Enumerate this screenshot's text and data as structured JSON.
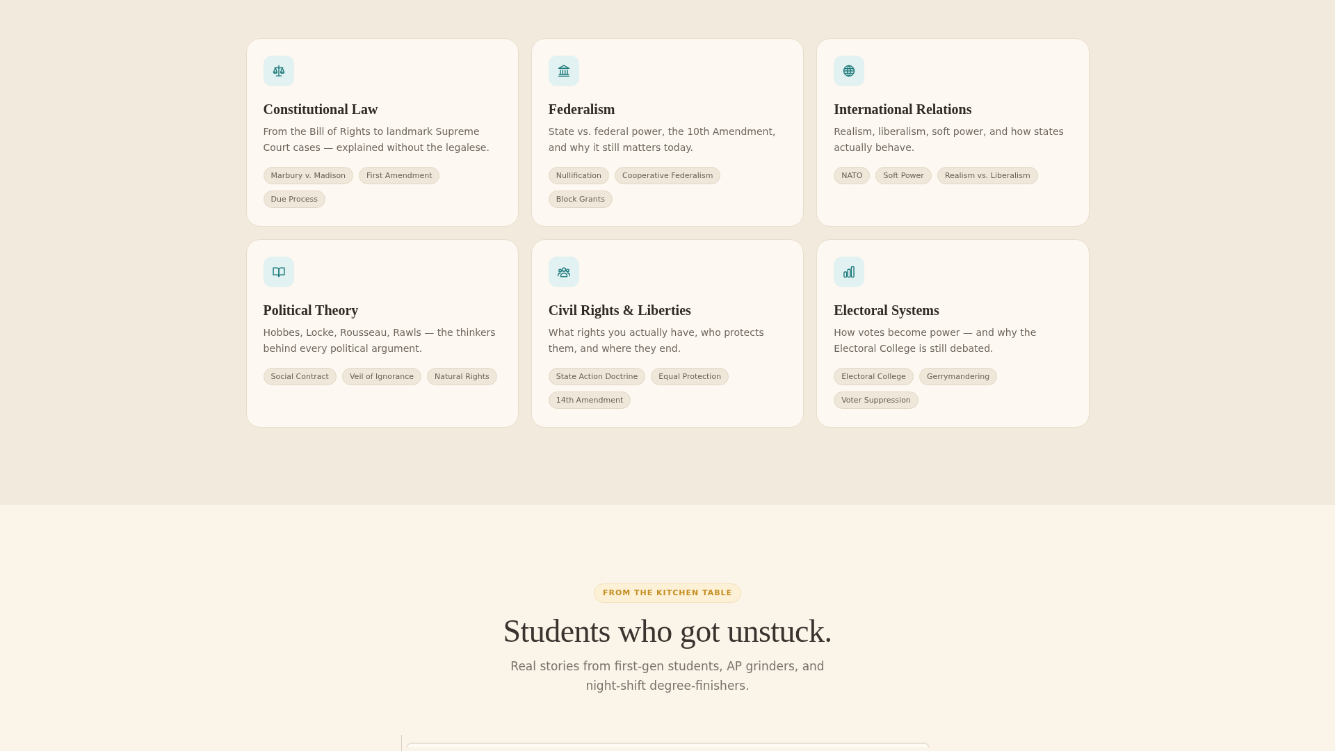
{
  "topics": [
    {
      "title": "Constitutional Law",
      "description": "From the Bill of Rights to landmark Supreme Court cases — explained without the legalese.",
      "tags": [
        "Marbury v. Madison",
        "First Amendment",
        "Due Process"
      ]
    },
    {
      "title": "Federalism",
      "description": "State vs. federal power, the 10th Amendment, and why it still matters today.",
      "tags": [
        "Nullification",
        "Cooperative Federalism",
        "Block Grants"
      ]
    },
    {
      "title": "International Relations",
      "description": "Realism, liberalism, soft power, and how states actually behave.",
      "tags": [
        "NATO",
        "Soft Power",
        "Realism vs. Liberalism"
      ]
    },
    {
      "title": "Political Theory",
      "description": "Hobbes, Locke, Rousseau, Rawls — the thinkers behind every political argument.",
      "tags": [
        "Social Contract",
        "Veil of Ignorance",
        "Natural Rights"
      ]
    },
    {
      "title": "Civil Rights & Liberties",
      "description": "What rights you actually have, who protects them, and where they end.",
      "tags": [
        "State Action Doctrine",
        "Equal Protection",
        "14th Amendment"
      ]
    },
    {
      "title": "Electoral Systems",
      "description": "How votes become power — and why the Electoral College is still debated.",
      "tags": [
        "Electoral College",
        "Gerrymandering",
        "Voter Suppression"
      ]
    }
  ],
  "testimonials": {
    "eyebrow": "FROM THE KITCHEN TABLE",
    "heading": "Students who got unstuck.",
    "subheading": "Real stories from first-gen students, AP grinders, and night-shift degree-finishers."
  }
}
